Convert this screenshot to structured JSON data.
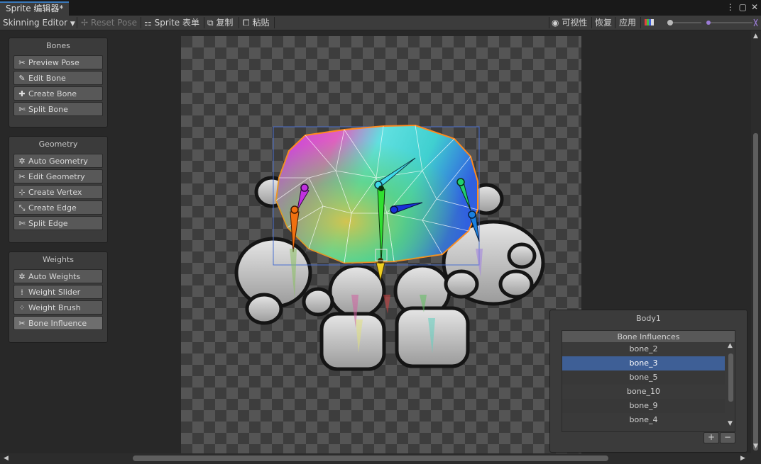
{
  "window": {
    "tab_title": "Sprite 编辑器*",
    "controls": [
      "⋮",
      "▢",
      "✕"
    ]
  },
  "toolbar": {
    "mode_dropdown": "Skinning Editor",
    "reset_pose": "Reset Pose",
    "sprite_sheet": "Sprite 表单",
    "copy": "复制",
    "paste": "粘贴",
    "visibility": "可视性",
    "revert": "恢复",
    "apply": "应用"
  },
  "panels": {
    "bones": {
      "title": "Bones",
      "buttons": [
        {
          "label": "Preview Pose",
          "icon": "preview-pose-icon"
        },
        {
          "label": "Edit Bone",
          "icon": "edit-bone-icon"
        },
        {
          "label": "Create Bone",
          "icon": "create-bone-icon"
        },
        {
          "label": "Split Bone",
          "icon": "split-bone-icon"
        }
      ]
    },
    "geometry": {
      "title": "Geometry",
      "buttons": [
        {
          "label": "Auto Geometry",
          "icon": "auto-geometry-icon"
        },
        {
          "label": "Edit Geometry",
          "icon": "edit-geometry-icon"
        },
        {
          "label": "Create Vertex",
          "icon": "create-vertex-icon"
        },
        {
          "label": "Create Edge",
          "icon": "create-edge-icon"
        },
        {
          "label": "Split Edge",
          "icon": "split-edge-icon"
        }
      ]
    },
    "weights": {
      "title": "Weights",
      "buttons": [
        {
          "label": "Auto Weights",
          "icon": "auto-weights-icon"
        },
        {
          "label": "Weight Slider",
          "icon": "weight-slider-icon"
        },
        {
          "label": "Weight Brush",
          "icon": "weight-brush-icon"
        },
        {
          "label": "Bone Influence",
          "icon": "bone-influence-icon",
          "active": true
        }
      ]
    }
  },
  "influence_panel": {
    "title": "Body1",
    "list_header": "Bone Influences",
    "bones": [
      "bone_2",
      "bone_3",
      "bone_5",
      "bone_10",
      "bone_9",
      "bone_4"
    ],
    "selected": "bone_3",
    "add_label": "+",
    "remove_label": "−"
  },
  "colors": {
    "selection": "#3e5f96",
    "tab_accent": "#3a79bb",
    "mesh_outline": "#ff8a1e"
  }
}
